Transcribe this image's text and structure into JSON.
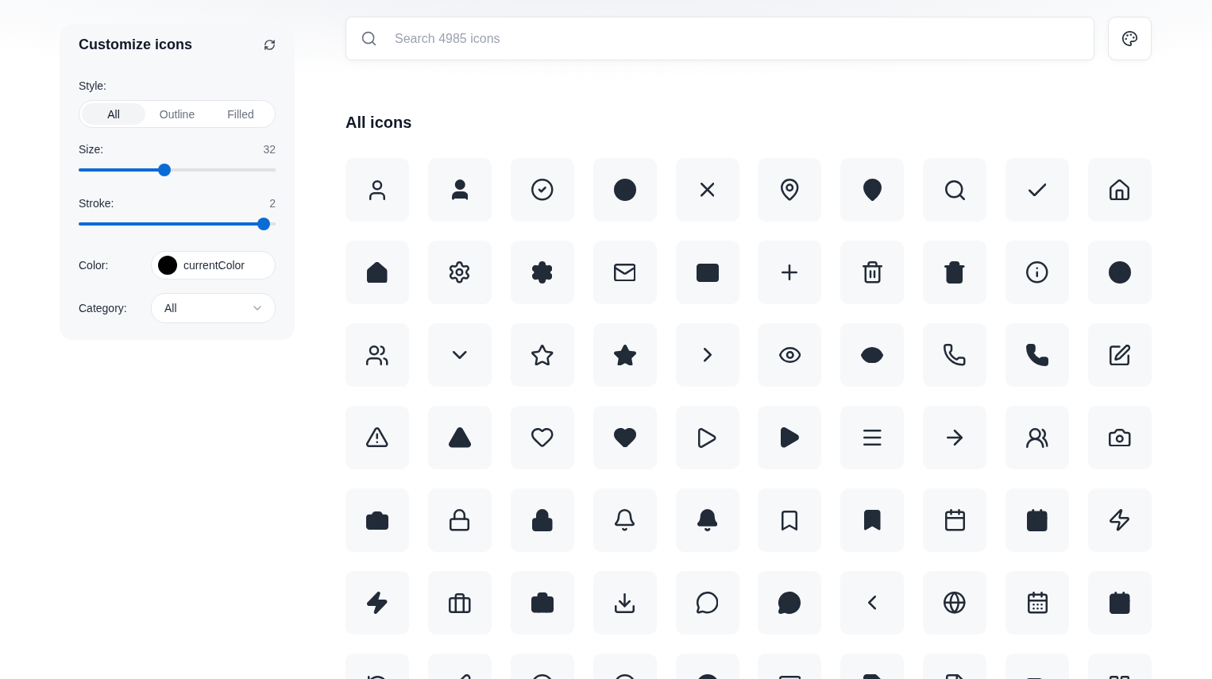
{
  "sidebar": {
    "title": "Customize icons",
    "style": {
      "label": "Style:",
      "options": [
        {
          "label": "All",
          "selected": true
        },
        {
          "label": "Outline",
          "selected": false
        },
        {
          "label": "Filled",
          "selected": false
        }
      ]
    },
    "size": {
      "label": "Size:",
      "reading": "32",
      "level": 0.43
    },
    "stroke": {
      "label": "Stroke:",
      "reading": "2",
      "level": 0.97
    },
    "color": {
      "label": "Color:",
      "value": "currentColor"
    },
    "category": {
      "label": "Category:",
      "value": "All"
    }
  },
  "search": {
    "placeholder": "Search 4985 icons"
  },
  "section_title": "All icons",
  "icons": [
    {
      "filled": false
    },
    {
      "filled": true
    },
    {
      "filled": false
    },
    {
      "filled": true
    },
    {
      "filled": false
    },
    {
      "filled": false
    },
    {
      "filled": true
    },
    {
      "filled": false
    },
    {
      "filled": false
    },
    {
      "filled": false
    },
    {
      "filled": true
    },
    {
      "filled": false
    },
    {
      "filled": true
    },
    {
      "filled": false
    },
    {
      "filled": true
    },
    {
      "filled": false
    },
    {
      "filled": false
    },
    {
      "filled": true
    },
    {
      "filled": false
    },
    {
      "filled": true
    },
    {
      "filled": false
    },
    {
      "filled": false
    },
    {
      "filled": false
    },
    {
      "filled": true
    },
    {
      "filled": false
    },
    {
      "filled": false
    },
    {
      "filled": true
    },
    {
      "filled": false
    },
    {
      "filled": true
    },
    {
      "filled": false
    },
    {
      "filled": false
    },
    {
      "filled": true
    },
    {
      "filled": false
    },
    {
      "filled": true
    },
    {
      "filled": false
    },
    {
      "filled": true
    },
    {
      "filled": false
    },
    {
      "filled": false
    },
    {
      "filled": false
    },
    {
      "filled": false
    },
    {
      "filled": true
    },
    {
      "filled": false
    },
    {
      "filled": true
    },
    {
      "filled": false
    },
    {
      "filled": true
    },
    {
      "filled": false
    },
    {
      "filled": true
    },
    {
      "filled": false
    },
    {
      "filled": true
    },
    {
      "filled": false
    },
    {
      "filled": true
    },
    {
      "filled": false
    },
    {
      "filled": true
    },
    {
      "filled": false
    },
    {
      "filled": false
    },
    {
      "filled": true
    },
    {
      "filled": false
    },
    {
      "filled": false
    },
    {
      "filled": false
    },
    {
      "filled": true
    },
    {
      "filled": false
    },
    {
      "filled": false
    },
    {
      "filled": false
    },
    {
      "filled": false
    },
    {
      "filled": true
    },
    {
      "filled": false
    },
    {
      "filled": true
    },
    {
      "filled": false
    },
    {
      "filled": true
    },
    {
      "filled": false
    }
  ]
}
